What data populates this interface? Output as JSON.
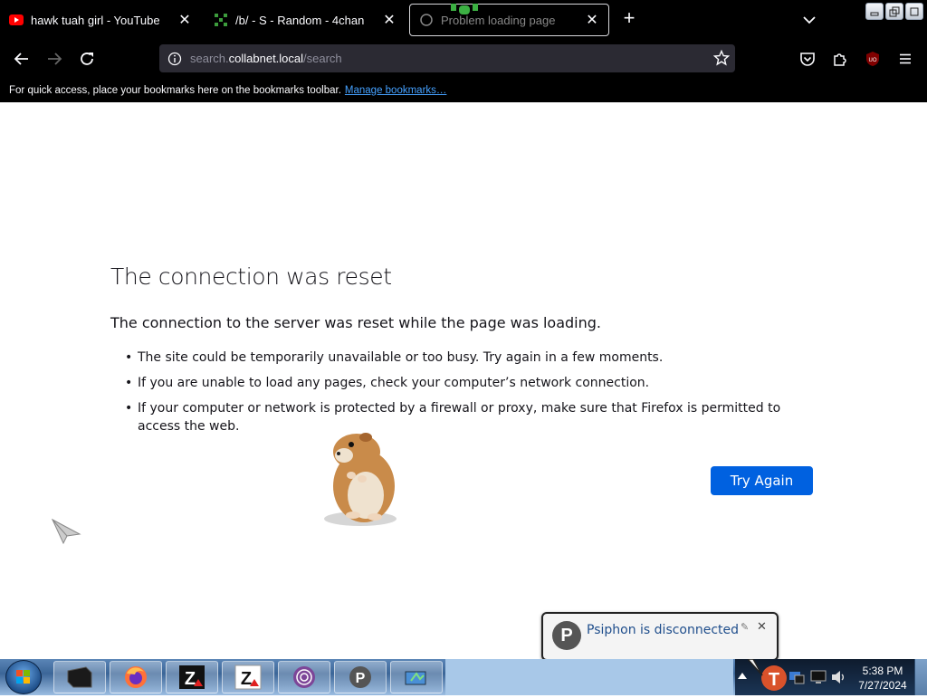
{
  "tabs": [
    {
      "title": "hawk tuah girl - YouTube",
      "icon": "youtube-icon",
      "active": false
    },
    {
      "title": "/b/ - S - Random - 4chan",
      "icon": "4chan-icon",
      "active": false
    },
    {
      "title": "Problem loading page",
      "icon": "warning-icon",
      "active": true
    }
  ],
  "url": {
    "prefix": "search.",
    "host": "collabnet.local",
    "path": "/search"
  },
  "bookmarks_bar": {
    "text": "For quick access, place your bookmarks here on the bookmarks toolbar.",
    "link": "Manage bookmarks…"
  },
  "error": {
    "title": "The connection was reset",
    "description": "The connection to the server was reset while the page was loading.",
    "bullets": [
      "The site could be temporarily unavailable or too busy. Try again in a few moments.",
      "If you are unable to load any pages, check your computer’s network connection.",
      "If your computer or network is protected by a firewall or proxy, make sure that Firefox is permitted to access the web."
    ],
    "button": "Try Again"
  },
  "notification": {
    "message": "Psiphon is disconnected"
  },
  "clock": {
    "time": "5:38 PM",
    "date": "7/27/2024"
  },
  "colors": {
    "accent": "#0061e0",
    "chrome": "#000000"
  }
}
